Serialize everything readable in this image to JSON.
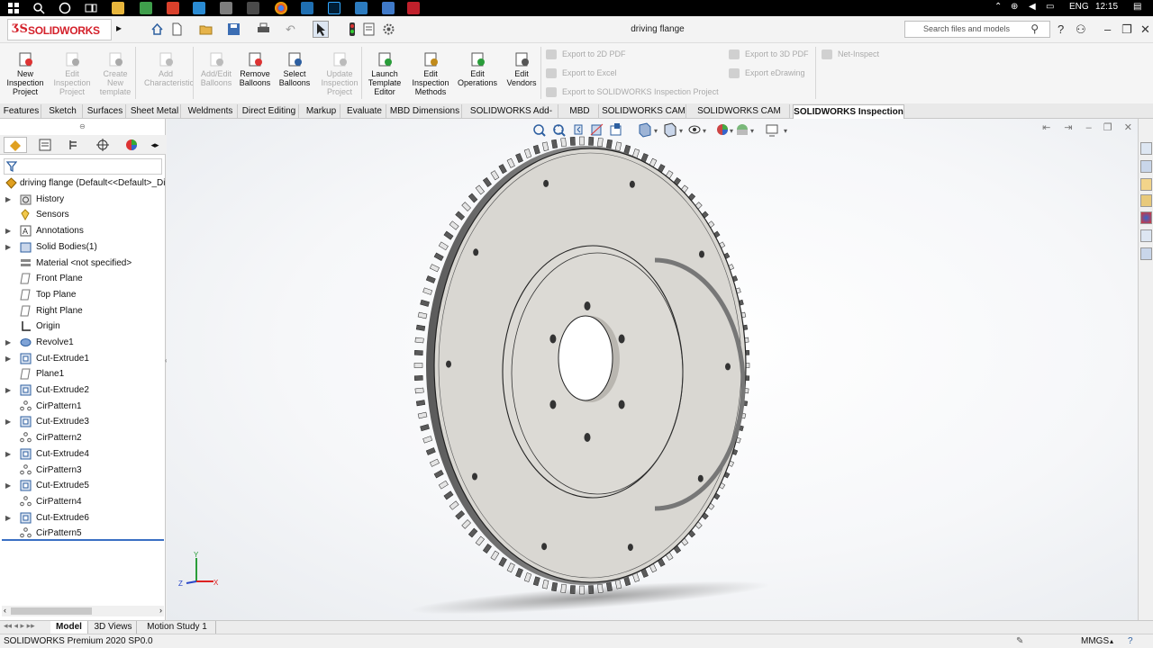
{
  "taskbar": {
    "language": "ENG",
    "time": "12:15"
  },
  "titlebar": {
    "app_name": "SOLIDWORKS",
    "document_title": "driving flange",
    "search_placeholder": "Search files and models"
  },
  "ribbon": {
    "buttons": [
      {
        "label": "New Inspection Project",
        "lines": [
          "New",
          "Inspection",
          "Project"
        ],
        "enabled": true
      },
      {
        "label": "Edit Inspection Project",
        "lines": [
          "Edit",
          "Inspection",
          "Project"
        ],
        "enabled": false
      },
      {
        "label": "Create New template",
        "lines": [
          "Create",
          "New",
          "template"
        ],
        "enabled": false
      },
      {
        "label": "Add Characteristic",
        "lines": [
          "Add",
          "Characteristic"
        ],
        "enabled": false
      },
      {
        "label": "Add/Edit Balloons",
        "lines": [
          "Add/Edit",
          "Balloons"
        ],
        "enabled": false
      },
      {
        "label": "Remove Balloons",
        "lines": [
          "Remove",
          "Balloons"
        ],
        "enabled": true
      },
      {
        "label": "Select Balloons",
        "lines": [
          "Select",
          "Balloons"
        ],
        "enabled": true
      },
      {
        "label": "Update Inspection Project",
        "lines": [
          "Update",
          "Inspection",
          "Project"
        ],
        "enabled": false
      },
      {
        "label": "Launch Template Editor",
        "lines": [
          "Launch",
          "Template",
          "Editor"
        ],
        "enabled": true
      },
      {
        "label": "Edit Inspection Methods",
        "lines": [
          "Edit",
          "Inspection",
          "Methods"
        ],
        "enabled": true
      },
      {
        "label": "Edit Operations",
        "lines": [
          "Edit",
          "Operations"
        ],
        "enabled": true
      },
      {
        "label": "Edit Vendors",
        "lines": [
          "Edit",
          "Vendors"
        ],
        "enabled": true
      }
    ],
    "export_items": [
      "Export to 2D PDF",
      "Export to Excel",
      "Export to SOLIDWORKS Inspection Project",
      "Export to 3D PDF",
      "Export eDrawing",
      "Net-Inspect"
    ]
  },
  "tabs": [
    "Features",
    "Sketch",
    "Surfaces",
    "Sheet Metal",
    "Weldments",
    "Direct Editing",
    "Markup",
    "Evaluate",
    "MBD Dimensions",
    "SOLIDWORKS Add-Ins",
    "MBD",
    "SOLIDWORKS CAM",
    "SOLIDWORKS CAM TBM",
    "SOLIDWORKS Inspection"
  ],
  "active_tab": "SOLIDWORKS Inspection",
  "feature_tree": {
    "root": "driving flange  (Default<<Default>_Di",
    "items": [
      {
        "label": "History",
        "icon": "history-folder-icon",
        "expandable": true
      },
      {
        "label": "Sensors",
        "icon": "sensors-icon",
        "expandable": false
      },
      {
        "label": "Annotations",
        "icon": "annotations-icon",
        "expandable": true
      },
      {
        "label": "Solid Bodies(1)",
        "icon": "solid-bodies-icon",
        "expandable": true
      },
      {
        "label": "Material <not specified>",
        "icon": "material-icon",
        "expandable": false
      },
      {
        "label": "Front Plane",
        "icon": "plane-icon",
        "expandable": false
      },
      {
        "label": "Top Plane",
        "icon": "plane-icon",
        "expandable": false
      },
      {
        "label": "Right Plane",
        "icon": "plane-icon",
        "expandable": false
      },
      {
        "label": "Origin",
        "icon": "origin-icon",
        "expandable": false
      },
      {
        "label": "Revolve1",
        "icon": "revolve-icon",
        "expandable": true
      },
      {
        "label": "Cut-Extrude1",
        "icon": "cut-extrude-icon",
        "expandable": true
      },
      {
        "label": "Plane1",
        "icon": "plane-icon",
        "expandable": false
      },
      {
        "label": "Cut-Extrude2",
        "icon": "cut-extrude-icon",
        "expandable": true
      },
      {
        "label": "CirPattern1",
        "icon": "circular-pattern-icon",
        "expandable": false
      },
      {
        "label": "Cut-Extrude3",
        "icon": "cut-extrude-icon",
        "expandable": true
      },
      {
        "label": "CirPattern2",
        "icon": "circular-pattern-icon",
        "expandable": false
      },
      {
        "label": "Cut-Extrude4",
        "icon": "cut-extrude-icon",
        "expandable": true
      },
      {
        "label": "CirPattern3",
        "icon": "circular-pattern-icon",
        "expandable": false
      },
      {
        "label": "Cut-Extrude5",
        "icon": "cut-extrude-icon",
        "expandable": true
      },
      {
        "label": "CirPattern4",
        "icon": "circular-pattern-icon",
        "expandable": false
      },
      {
        "label": "Cut-Extrude6",
        "icon": "cut-extrude-icon",
        "expandable": true
      },
      {
        "label": "CirPattern5",
        "icon": "circular-pattern-icon",
        "expandable": false
      }
    ]
  },
  "triad": {
    "x": "X",
    "y": "Y",
    "z": "Z"
  },
  "bottom_tabs": [
    "Model",
    "3D Views",
    "Motion Study 1"
  ],
  "active_bottom_tab": "Model",
  "status": {
    "version": "SOLIDWORKS Premium 2020 SP0.0",
    "units": "MMGS"
  },
  "colors": {
    "brand_red": "#d4212b",
    "part_face": "#d9d7d2",
    "selection_blue": "#3a6fc4"
  }
}
